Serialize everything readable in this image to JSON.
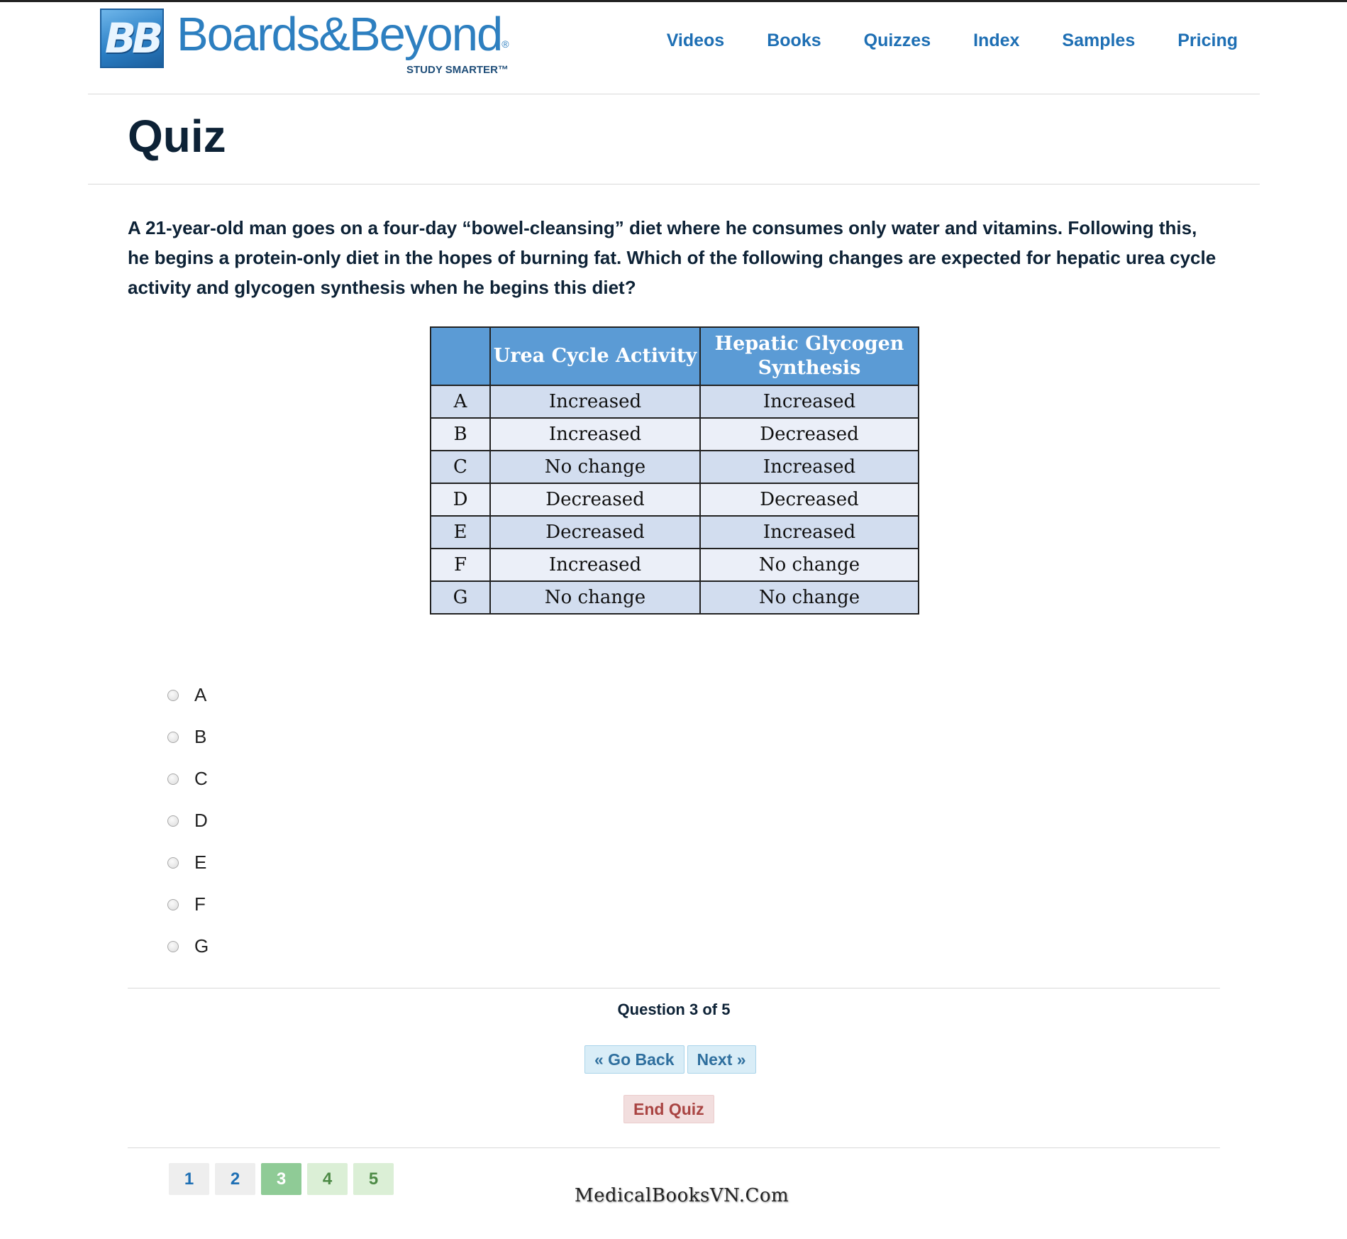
{
  "brand": {
    "logo_mark": "BB",
    "name": "Boards&Beyond",
    "registered": "®",
    "tagline": "STUDY SMARTER™"
  },
  "nav": {
    "items": [
      "Videos",
      "Books",
      "Quizzes",
      "Index",
      "Samples",
      "Pricing"
    ]
  },
  "page_title": "Quiz",
  "question": {
    "text": "A 21-year-old man goes on a four-day “bowel-cleansing” diet where he consumes only water and vitamins. Following this, he begins a protein-only diet in the hopes of burning fat. Which of the following changes are expected for hepatic urea cycle activity and glycogen synthesis when he begins this diet?"
  },
  "answer_table": {
    "headers": [
      "",
      "Urea Cycle Activity",
      "Hepatic Glycogen Synthesis"
    ],
    "rows": [
      [
        "A",
        "Increased",
        "Increased"
      ],
      [
        "B",
        "Increased",
        "Decreased"
      ],
      [
        "C",
        "No change",
        "Increased"
      ],
      [
        "D",
        "Decreased",
        "Decreased"
      ],
      [
        "E",
        "Decreased",
        "Increased"
      ],
      [
        "F",
        "Increased",
        "No change"
      ],
      [
        "G",
        "No change",
        "No change"
      ]
    ],
    "colors": {
      "header_bg": "#5b9bd5",
      "row_odd": "#d2ddef",
      "row_even": "#ebeff8"
    }
  },
  "options": [
    "A",
    "B",
    "C",
    "D",
    "E",
    "F",
    "G"
  ],
  "status": "Question 3 of 5",
  "buttons": {
    "go_back": "« Go Back",
    "next": "Next »",
    "end_quiz": "End Quiz"
  },
  "pager": {
    "pages": [
      "1",
      "2",
      "3",
      "4",
      "5"
    ],
    "current": "3"
  },
  "watermark": "MedicalBooksVN.Com"
}
